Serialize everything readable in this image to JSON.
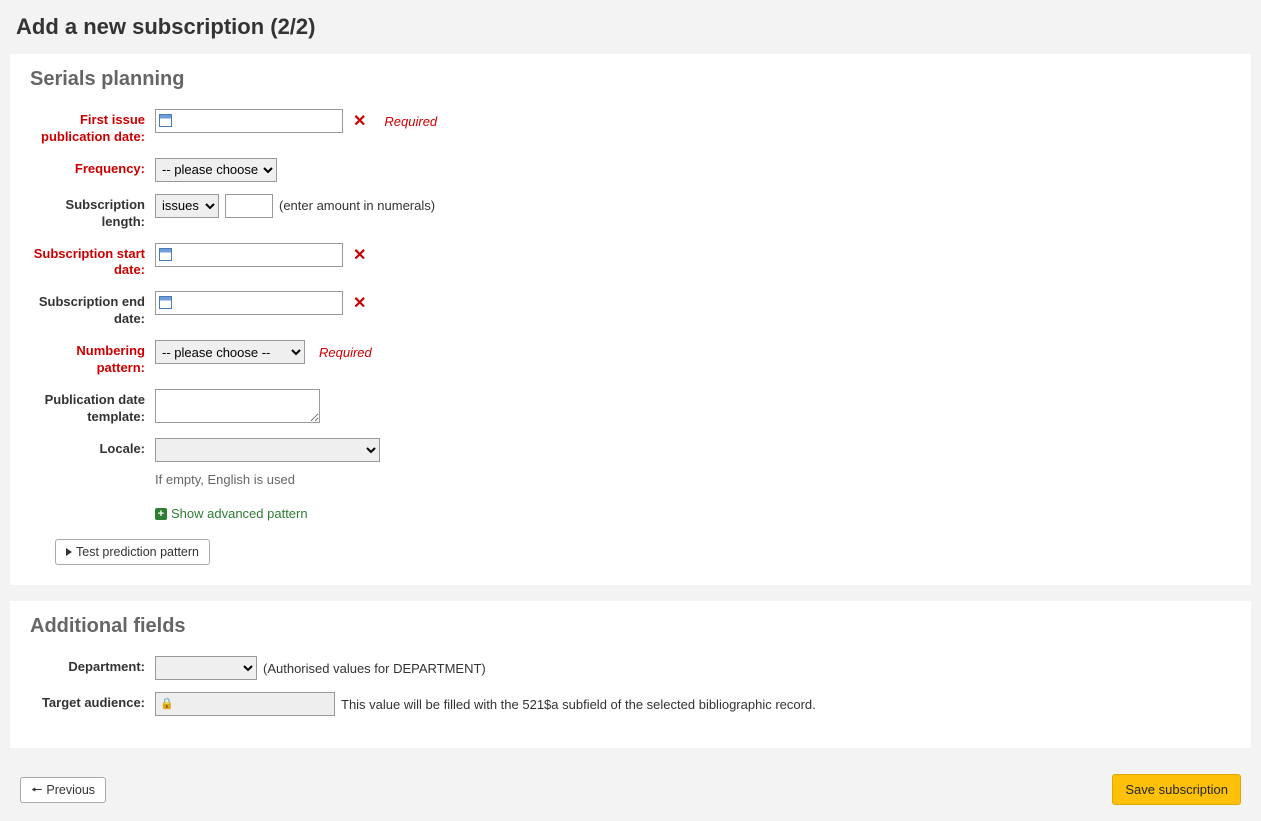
{
  "page": {
    "title": "Add a new subscription (2/2)"
  },
  "planning": {
    "heading": "Serials planning",
    "first_issue": {
      "label": "First issue publication date:",
      "value": "",
      "required_tag": "Required"
    },
    "frequency": {
      "label": "Frequency:",
      "placeholder_option": "-- please choose --"
    },
    "sub_length": {
      "label": "Subscription length:",
      "unit_option": "issues",
      "amount": "",
      "hint": "(enter amount in numerals)"
    },
    "start_date": {
      "label": "Subscription start date:",
      "value": ""
    },
    "end_date": {
      "label": "Subscription end date:",
      "value": ""
    },
    "numbering": {
      "label": "Numbering pattern:",
      "placeholder_option": "-- please choose --",
      "required_tag": "Required"
    },
    "pub_template": {
      "label": "Publication date template:",
      "value": ""
    },
    "locale": {
      "label": "Locale:",
      "hint": "If empty, English is used"
    },
    "advanced_link": "Show advanced pattern",
    "test_button": "Test prediction pattern"
  },
  "additional": {
    "heading": "Additional fields",
    "department": {
      "label": "Department:",
      "hint": "(Authorised values for DEPARTMENT)"
    },
    "target_audience": {
      "label": "Target audience:",
      "value": "",
      "hint": "This value will be filled with the 521$a subfield of the selected bibliographic record."
    }
  },
  "footer": {
    "previous": "Previous",
    "save": "Save subscription"
  }
}
